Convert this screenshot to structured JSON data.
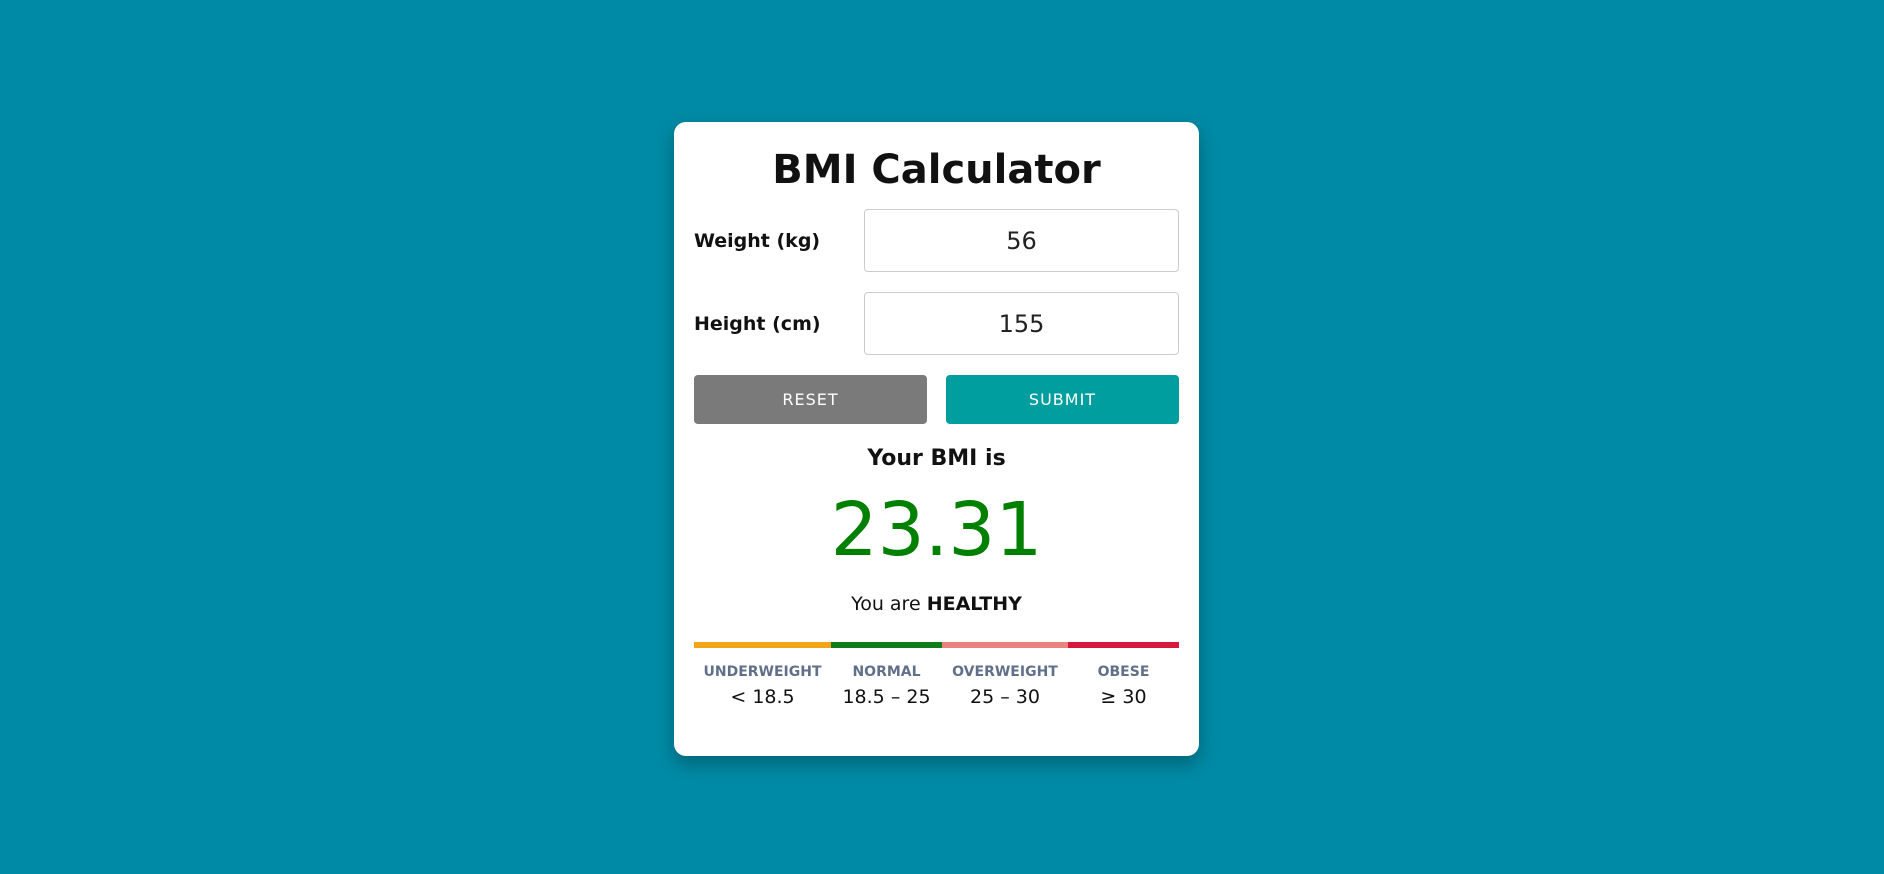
{
  "title": "BMI Calculator",
  "form": {
    "weight_label": "Weight (kg)",
    "weight_value": "56",
    "height_label": "Height (cm)",
    "height_value": "155"
  },
  "buttons": {
    "reset_label": "RESET",
    "submit_label": "SUBMIT"
  },
  "result": {
    "heading": "Your BMI is",
    "value": "23.31",
    "status_prefix": "You are",
    "status": "HEALTHY",
    "value_color": "#008000"
  },
  "scale": [
    {
      "category": "UNDERWEIGHT",
      "range": "< 18.5",
      "color": "#f2a516"
    },
    {
      "category": "NORMAL",
      "range": "18.5 – 25",
      "color": "#0f7d1a"
    },
    {
      "category": "OVERWEIGHT",
      "range": "25 – 30",
      "color": "#e88380"
    },
    {
      "category": "OBESE",
      "range": "≥ 30",
      "color": "#d6183c"
    }
  ],
  "colors": {
    "background": "#018aa5",
    "card": "#ffffff",
    "reset_button": "#7a7a7a",
    "submit_button": "#009e9e"
  }
}
